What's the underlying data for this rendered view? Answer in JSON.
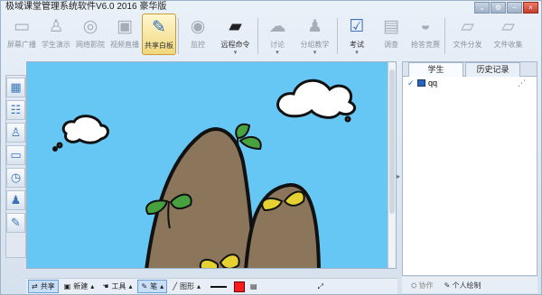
{
  "window": {
    "title": "极域课堂管理系统软件V6.0 2016 豪华版",
    "buttons": [
      "⌄",
      "⚙",
      "−",
      "×"
    ]
  },
  "toolbar": {
    "items": [
      {
        "label": "屏幕广播",
        "icon": "monitor-icon",
        "active": false,
        "disabled": true
      },
      {
        "label": "学生演示",
        "icon": "presenter-icon",
        "active": false,
        "disabled": true
      },
      {
        "label": "网络影院",
        "icon": "film-icon",
        "active": false,
        "disabled": true
      },
      {
        "label": "视频直播",
        "icon": "camera-icon",
        "active": false,
        "disabled": true
      },
      {
        "label": "共享白板",
        "icon": "whiteboard-icon",
        "active": true,
        "disabled": false
      },
      {
        "label": "监控",
        "icon": "eye-icon",
        "active": false,
        "disabled": true
      },
      {
        "label": "远程命令",
        "icon": "terminal-icon",
        "active": false,
        "disabled": false
      },
      {
        "label": "讨论",
        "icon": "chat-icon",
        "active": false,
        "disabled": true
      },
      {
        "label": "分组教学",
        "icon": "group-icon",
        "active": false,
        "disabled": true
      },
      {
        "label": "考试",
        "icon": "exam-icon",
        "active": false,
        "disabled": false
      },
      {
        "label": "调查",
        "icon": "survey-icon",
        "active": false,
        "disabled": true
      },
      {
        "label": "抢答竞赛",
        "icon": "buzzer-icon",
        "active": false,
        "disabled": true
      },
      {
        "label": "文件分发",
        "icon": "file-send-icon",
        "active": false,
        "disabled": true
      },
      {
        "label": "文件收集",
        "icon": "file-collect-icon",
        "active": false,
        "disabled": true
      }
    ]
  },
  "left_tools": [
    "grid-icon",
    "list-icon",
    "student-remove-icon",
    "copy-icon",
    "clock-icon",
    "user-add-icon",
    "pencil-icon"
  ],
  "bottom_toolbar": {
    "share_label": "共享",
    "new_label": "新建",
    "tool_label": "工具",
    "pen_label": "笔",
    "shape_label": "图形"
  },
  "right_panel": {
    "tabs": [
      "学生",
      "历史记录"
    ],
    "students": [
      {
        "name": "qq",
        "checked": true
      }
    ],
    "footer": [
      "协作",
      "个人绘制"
    ]
  },
  "colors": {
    "sky": "#66c7f4",
    "mountain": "#8b765c",
    "leaf": "#48a13f",
    "leaf_yellow": "#e5d12f",
    "selected_color": "#ff1b1b",
    "accent": "#2f70c8"
  }
}
